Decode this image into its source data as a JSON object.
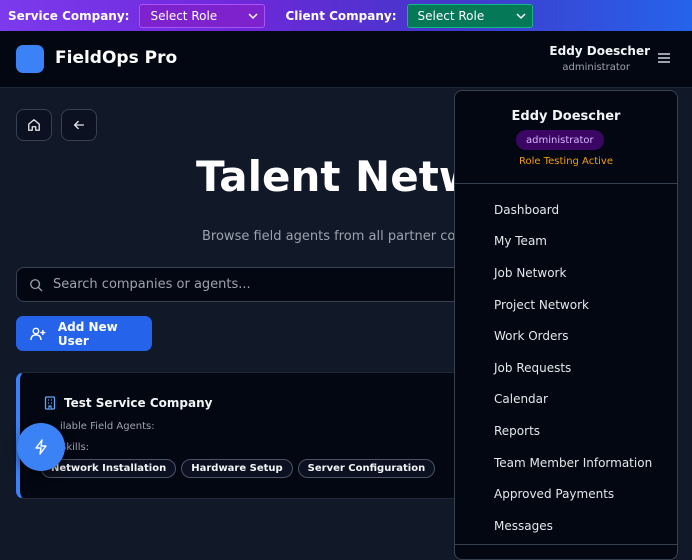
{
  "role_bar": {
    "service_label": "Service Company:",
    "service_value": "Select Role",
    "client_label": "Client Company:",
    "client_value": "Select Role"
  },
  "header": {
    "brand": "FieldOps Pro",
    "user_name": "Eddy Doescher",
    "user_role": "administrator"
  },
  "main": {
    "title": "Talent Netwo",
    "subtitle": "Browse field agents from all partner comp",
    "search_placeholder": "Search companies or agents...",
    "add_user_label": "Add New User"
  },
  "card": {
    "company_name": "Test Service Company",
    "agents_label": "ilable Field Agents:",
    "skills_label": "Skills:",
    "skills": [
      "Network Installation",
      "Hardware Setup",
      "Server Configuration"
    ]
  },
  "dropdown": {
    "name": "Eddy Doescher",
    "role_badge": "administrator",
    "status": "Role Testing Active",
    "items": [
      "Dashboard",
      "My Team",
      "Job Network",
      "Project Network",
      "Work Orders",
      "Job Requests",
      "Calendar",
      "Reports",
      "Team Member Information",
      "Approved Payments",
      "Messages"
    ]
  },
  "colors": {
    "accent": "#3b82f6",
    "service_select": "#7e22ce",
    "client_select": "#047857",
    "status": "#f59e0b"
  },
  "icons": {
    "home": "home-icon",
    "back": "arrow-left-icon",
    "search": "search-icon",
    "add_user": "user-plus-icon",
    "company": "building-icon",
    "fab": "zap-icon",
    "menu": "menu-icon"
  }
}
